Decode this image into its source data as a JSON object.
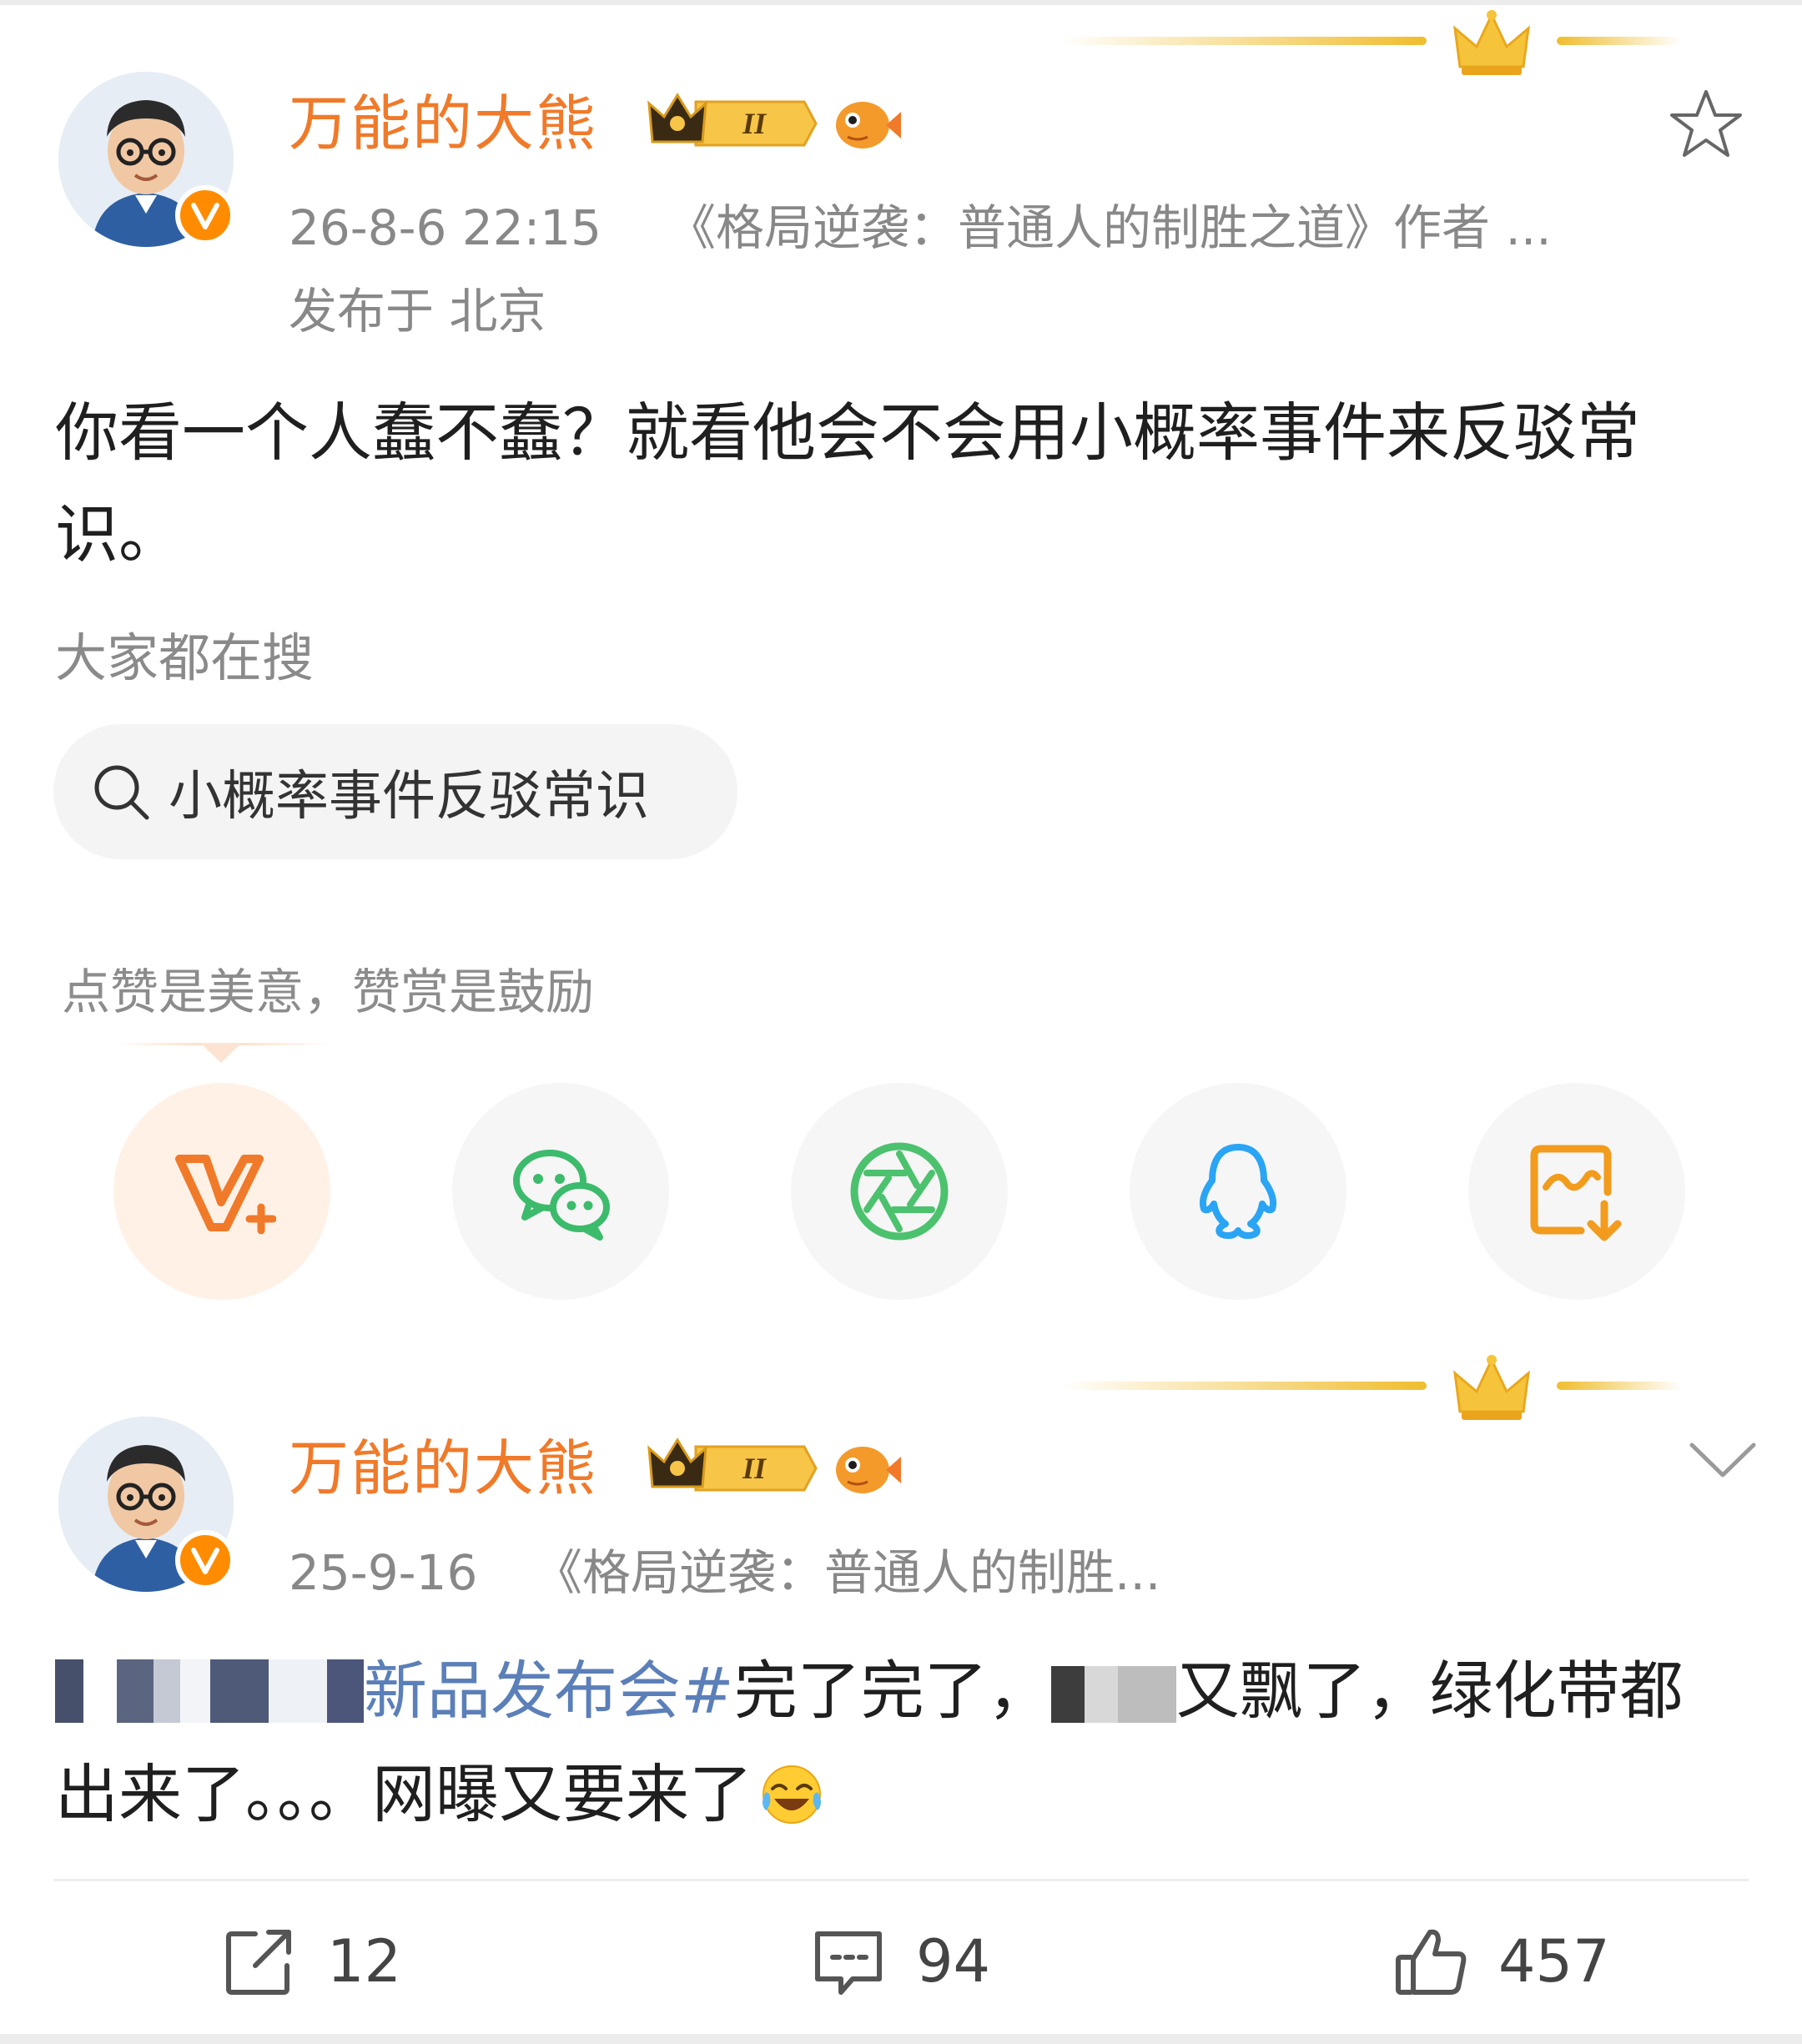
{
  "posts": [
    {
      "author": "万能的大熊",
      "level_badge": "II",
      "time": "26-8-6 22:15",
      "source": "《格局逆袭：普通人的制胜之道》作者 ...",
      "location": "发布于 北京",
      "text_line1": "你看一个人蠢不蠢？就看他会不会用小概率事件来反驳常",
      "text_line2": "识。",
      "trending_label": "大家都在搜",
      "trending_query": "小概率事件反驳常识",
      "tip_label": "点赞是美意，赞赏是鼓励",
      "share_buttons": [
        {
          "name": "weibo-vplus",
          "icon": "v-plus-icon",
          "color": "#f07a2a"
        },
        {
          "name": "wechat",
          "icon": "wechat-icon",
          "color": "#3dbb6c"
        },
        {
          "name": "moments",
          "icon": "moments-shutter-icon",
          "color": "#4cc16e"
        },
        {
          "name": "qq",
          "icon": "qq-penguin-icon",
          "color": "#2aa4f4"
        },
        {
          "name": "save-image",
          "icon": "save-image-icon",
          "color": "#f29b1d"
        }
      ]
    },
    {
      "author": "万能的大熊",
      "level_badge": "II",
      "time": "25-9-16",
      "source": "《格局逆袭：普通人的制胜...",
      "text_hashtag": "新品发布会#",
      "text_mid": "完了完了，",
      "text_after_blur": "又飘了，绿化带都",
      "text_line2": "出来了。。。网曝又要来了",
      "emoji": "laughing-tears-emoji",
      "actions": {
        "repost_count": "12",
        "comment_count": "94",
        "like_count": "457"
      }
    }
  ],
  "colors": {
    "username": "#f07a2a",
    "meta": "#888888",
    "hashtag": "#5b7fb8",
    "crown_gold": "#f0bd2e"
  }
}
